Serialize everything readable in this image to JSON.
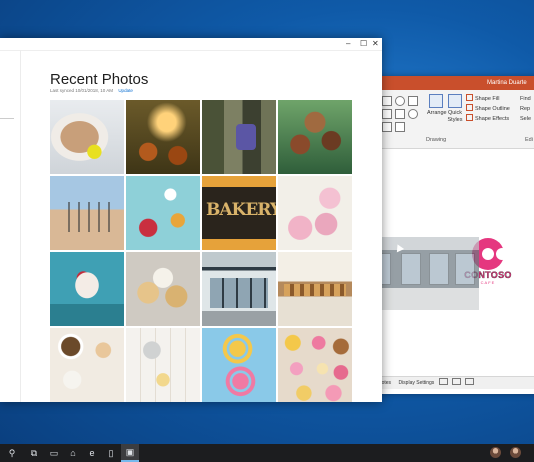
{
  "powerpoint": {
    "user_name": "Martina Duarte",
    "ribbon": {
      "arrange_label": "Arrange",
      "quick_styles_label": "Quick Styles",
      "shape_fill_label": "Shape Fill",
      "shape_outline_label": "Shape Outline",
      "shape_effects_label": "Shape Effects",
      "find_label": "Find",
      "replace_label": "Rep",
      "select_label": "Sele",
      "drawing_group_label": "Drawing",
      "editing_group_label": "Edi"
    },
    "slide_logo": {
      "name": "CONTOSO",
      "sub": "CAFE",
      "color": "#e5377f"
    },
    "status": {
      "notes_label": "Notes",
      "display_settings_label": "Display Settings"
    },
    "title_bar_color": "#c94f2c"
  },
  "photos_app": {
    "title": "Recent Photos",
    "last_synced": "Last synced 10/01/2018, 10 AM",
    "update_link": "Update",
    "window_controls": {
      "minimize": "–",
      "maximize": "☐",
      "close": "✕"
    },
    "photos": [
      {
        "subject": "puppy-with-ball"
      },
      {
        "subject": "autumn-bokeh"
      },
      {
        "subject": "feet-on-rocks"
      },
      {
        "subject": "family-selfie"
      },
      {
        "subject": "beach-people"
      },
      {
        "subject": "baking-flatlay"
      },
      {
        "subject": "bakery-sign"
      },
      {
        "subject": "pink-macarons"
      },
      {
        "subject": "cheesecake"
      },
      {
        "subject": "cupcakes"
      },
      {
        "subject": "cafe-storefront"
      },
      {
        "subject": "pastry-counter"
      },
      {
        "subject": "baking-ingredients"
      },
      {
        "subject": "kitchen-tools"
      },
      {
        "subject": "two-donuts"
      },
      {
        "subject": "donut-assortment"
      }
    ]
  },
  "taskbar": {
    "icons": [
      "search-icon",
      "task-view-icon",
      "file-explorer-icon",
      "store-icon",
      "edge-icon",
      "phone-icon",
      "photos-icon"
    ],
    "glyphs": [
      "⚲",
      "⧉",
      "▭",
      "⌂",
      "e",
      "▯",
      "▣"
    ]
  }
}
